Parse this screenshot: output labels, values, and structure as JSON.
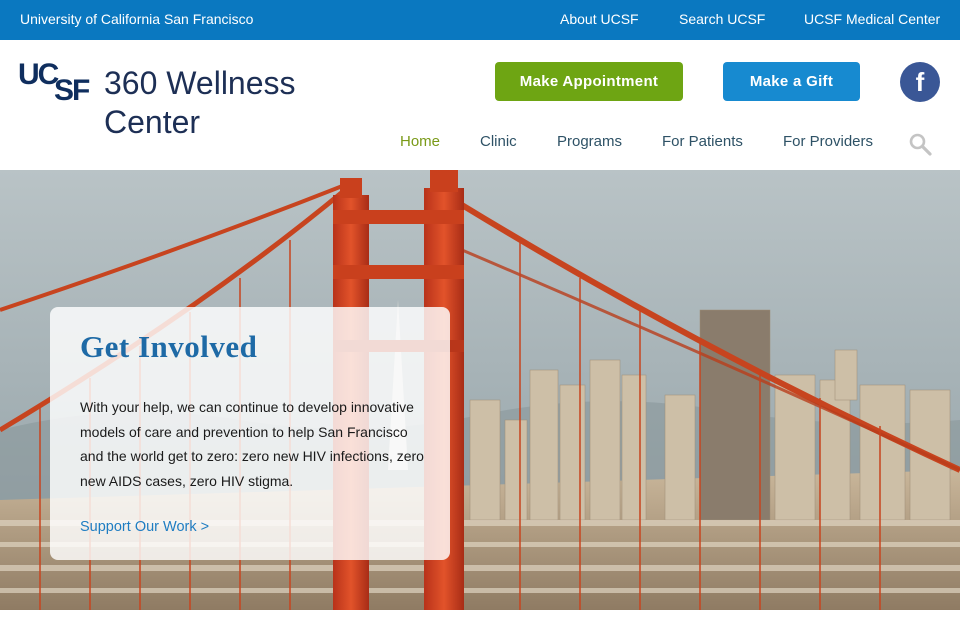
{
  "topbar": {
    "university": "University of California San Francisco",
    "about": "About UCSF",
    "search": "Search UCSF",
    "medical_center": "UCSF Medical Center"
  },
  "header": {
    "logo_text_top": "UC",
    "logo_text_bottom": "SF",
    "site_title": "360 Wellness Center",
    "appointment_button": "Make Appointment",
    "gift_button": "Make a Gift",
    "facebook_glyph": "f"
  },
  "nav": {
    "items": [
      {
        "label": "Home",
        "active": true
      },
      {
        "label": "Clinic",
        "active": false
      },
      {
        "label": "Programs",
        "active": false
      },
      {
        "label": "For Patients",
        "active": false
      },
      {
        "label": "For Providers",
        "active": false
      }
    ],
    "search_icon": "search-icon"
  },
  "hero": {
    "title": "Get Involved",
    "body": "With your help, we can continue to develop innovative models of care and prevention to help San Francisco and the world get to zero: zero new HIV infections, zero new AIDS cases, zero HIV stigma.",
    "link": "Support Our Work >"
  },
  "colors": {
    "topbar": "#0a78c0",
    "appointment": "#6ea513",
    "gift": "#178ad0",
    "facebook": "#3a5796",
    "nav_active": "#7a9a18",
    "nav_text": "#2e5266",
    "card_title": "#1e6aa6",
    "link": "#1f7dc2",
    "bridge": "#d8491f"
  }
}
